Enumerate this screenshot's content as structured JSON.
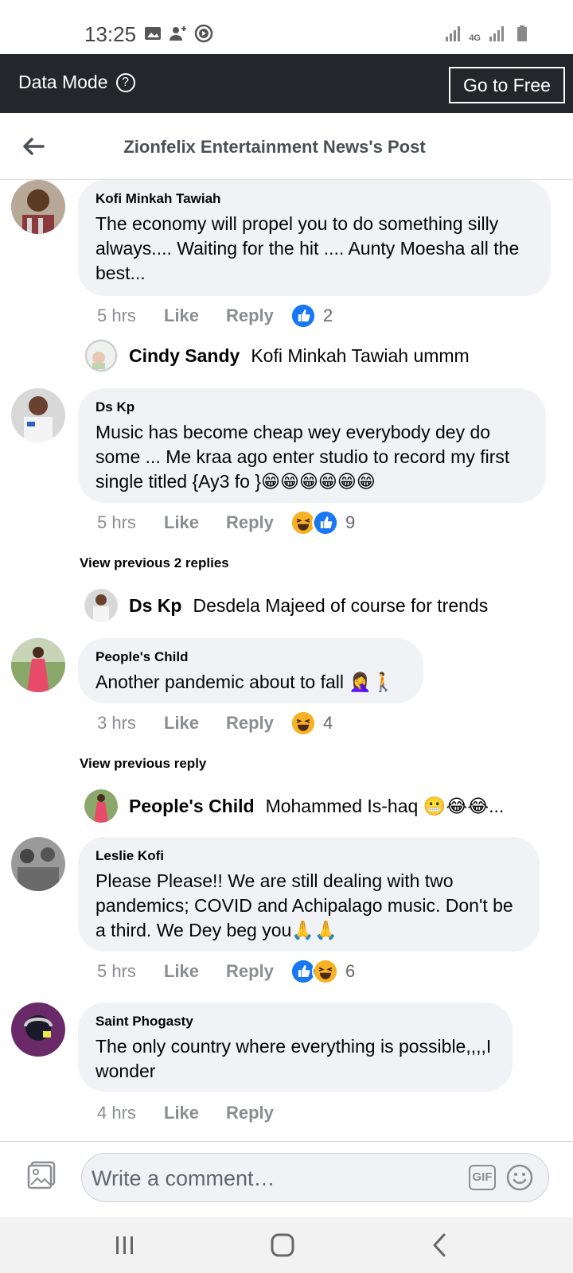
{
  "status_bar": {
    "time": "13:25",
    "network": "4G"
  },
  "data_bar": {
    "label": "Data Mode",
    "help": "?",
    "go_free": "Go to Free"
  },
  "header": {
    "title": "Zionfelix Entertainment News's Post"
  },
  "comments": [
    {
      "author": "Kofi Minkah Tawiah",
      "text": "The economy will propel you to do something silly always....  Waiting for the hit .... Aunty Moesha all the best...",
      "time": "5 hrs",
      "like": "Like",
      "reply": "Reply",
      "reaction_count": "2"
    },
    {
      "author": "Ds Kp",
      "text": "Music has become cheap wey everybody dey do some ...  Me kraa ago enter studio to record my first single titled {Ay3 fo }😁😁😁😁😁😁",
      "time": "5 hrs",
      "like": "Like",
      "reply": "Reply",
      "reaction_count": "9"
    },
    {
      "author": "People's Child",
      "text": "Another pandemic about to fall 🤦‍♀️🚶",
      "time": "3 hrs",
      "like": "Like",
      "reply": "Reply",
      "reaction_count": "4"
    },
    {
      "author": "Leslie Kofi",
      "text": "Please Please!! We are still dealing with two pandemics; COVID and Achipalago music. Don't be a third. We Dey beg you🙏🙏",
      "time": "5 hrs",
      "like": "Like",
      "reply": "Reply",
      "reaction_count": "6"
    },
    {
      "author": "Saint Phogasty",
      "text": "The only country where everything is possible,,,,I wonder",
      "time": "4 hrs",
      "like": "Like",
      "reply": "Reply"
    }
  ],
  "replies": [
    {
      "name": "Cindy Sandy",
      "text": "Kofi Minkah Tawiah ummm"
    },
    {
      "name": "Ds Kp",
      "text": "Desdela Majeed of course for trends"
    },
    {
      "name": "People's Child",
      "text": "Mohammed Is-haq 😬😂😂..."
    }
  ],
  "view_previous": [
    "View previous 2 replies",
    "View previous reply"
  ],
  "composer": {
    "placeholder": "Write a comment…",
    "gif": "GIF"
  },
  "colors": {
    "like_blue": "#1877f2",
    "haha_yellow": "#f7b125",
    "bubble": "#f0f2f5",
    "data_bar": "#23272b"
  }
}
